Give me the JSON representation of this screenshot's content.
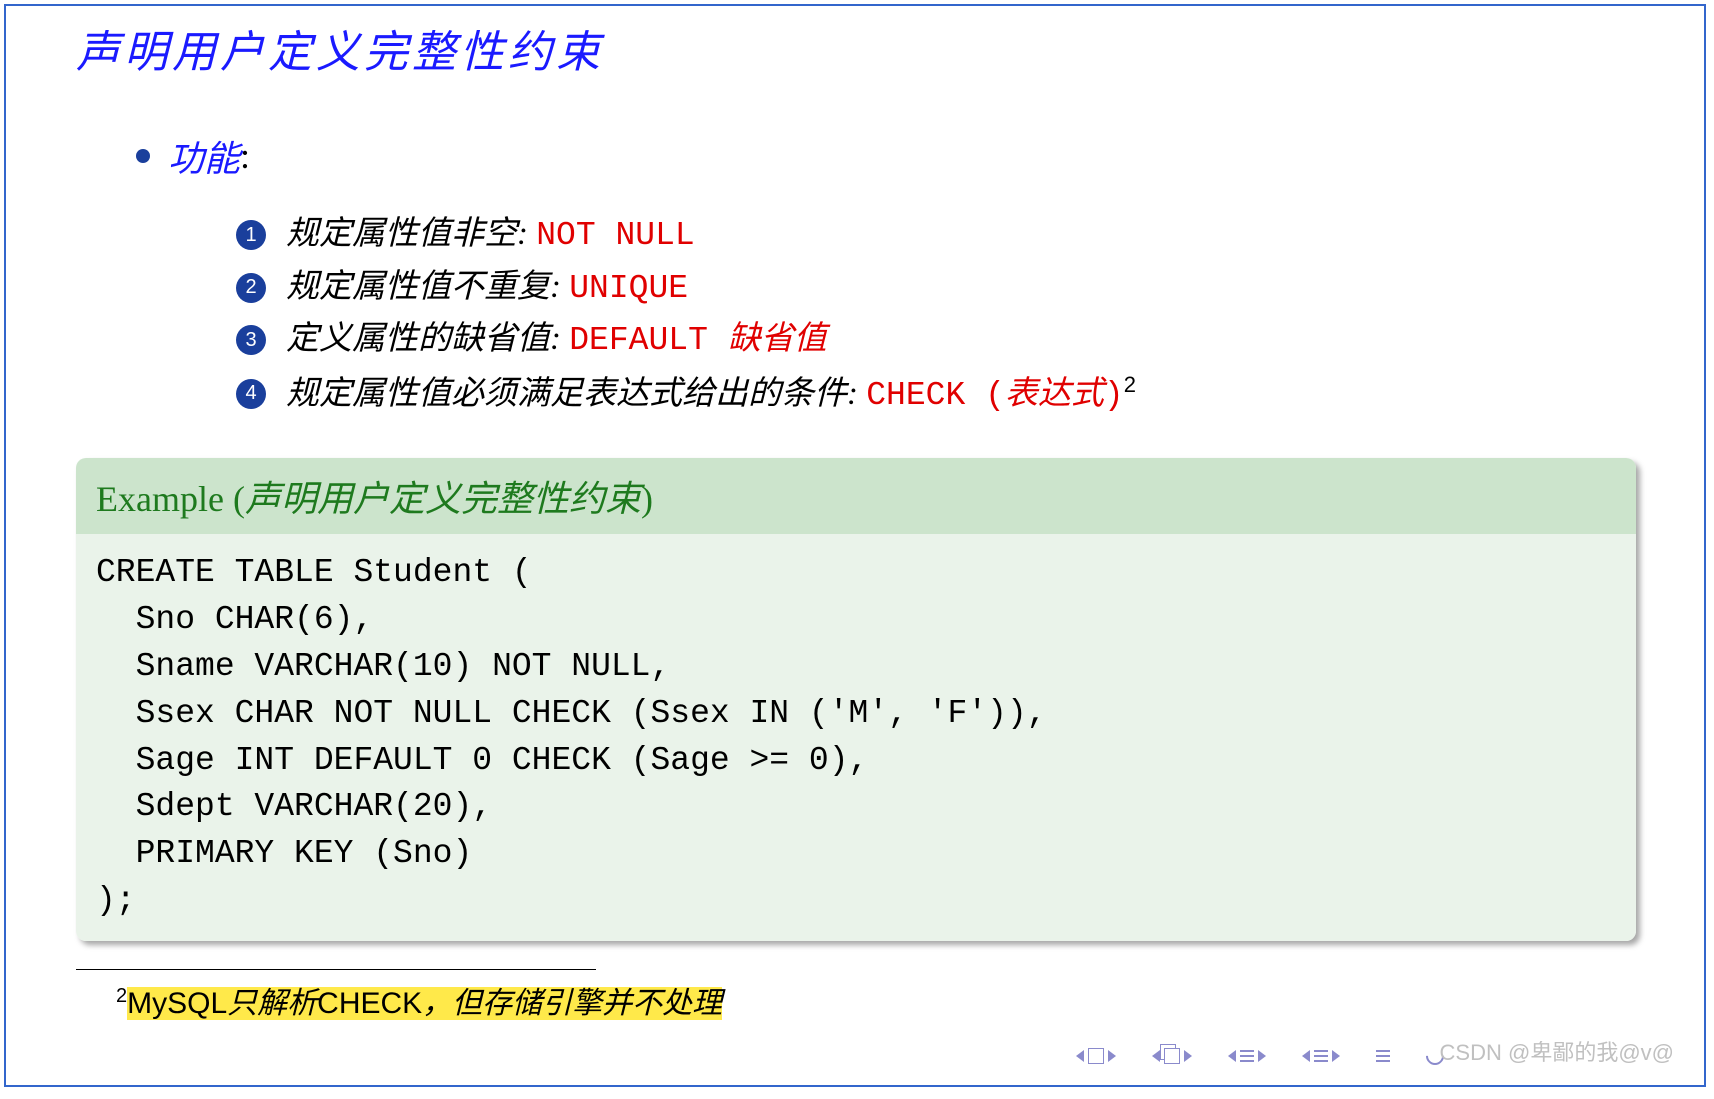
{
  "title": "声明用户定义完整性约束",
  "bullet": {
    "label": "功能",
    "colon": ":"
  },
  "items": [
    {
      "num": "1",
      "text": "规定属性值非空: ",
      "code": "NOT NULL"
    },
    {
      "num": "2",
      "text": "规定属性值不重复: ",
      "code": "UNIQUE"
    },
    {
      "num": "3",
      "text": "定义属性的缺省值: ",
      "code": "DEFAULT ",
      "redkai": "缺省值"
    },
    {
      "num": "4",
      "text": "规定属性值必须满足表达式给出的条件: ",
      "code": "CHECK (",
      "redkai": "表达式",
      "code2": ")",
      "sup": "2"
    }
  ],
  "example": {
    "header_word": "Example (",
    "header_cn": "声明用户定义完整性约束",
    "header_close": ")",
    "body": "CREATE TABLE Student (\n  Sno CHAR(6),\n  Sname VARCHAR(10) NOT NULL,\n  Ssex CHAR NOT NULL CHECK (Ssex IN ('M', 'F')),\n  Sage INT DEFAULT 0 CHECK (Sage >= 0),\n  Sdept VARCHAR(20),\n  PRIMARY KEY (Sno)\n);"
  },
  "footnote": {
    "sup": "2",
    "part1_latin": "MySQL",
    "part1_cn": "只解析",
    "part1_latin2": "CHECK",
    "part1_comma": "，",
    "part2": "但存储引擎并不处理"
  },
  "watermark": "CSDN @卑鄙的我@v@"
}
